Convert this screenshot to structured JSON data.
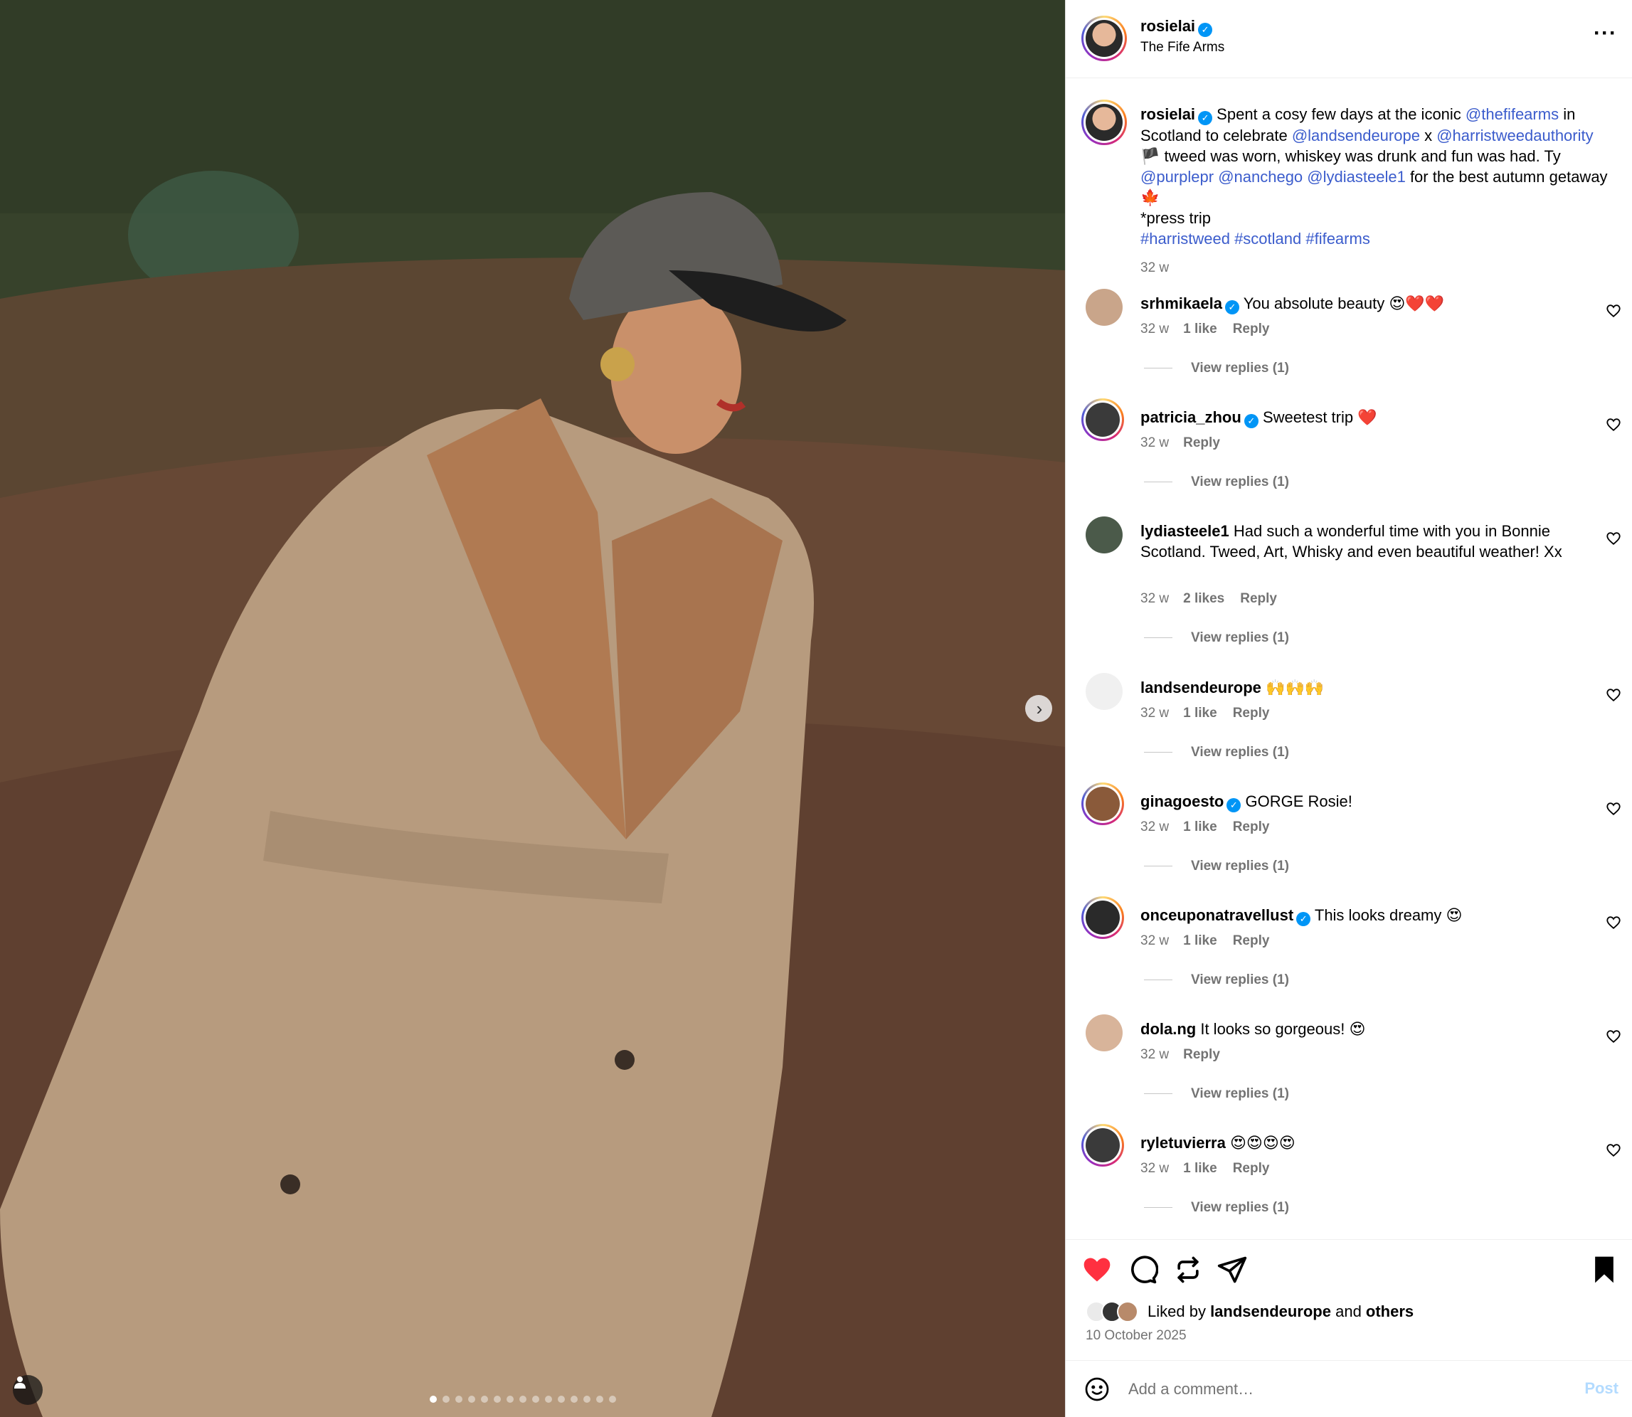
{
  "header": {
    "username": "rosielai",
    "location": "The Fife Arms"
  },
  "caption": {
    "username": "rosielai",
    "parts": [
      {
        "t": "Spent a cosy few days at the iconic ",
        "link": false
      },
      {
        "t": "@thefifearms",
        "link": true
      },
      {
        "t": " in Scotland to celebrate ",
        "link": false
      },
      {
        "t": "@landsendeurope",
        "link": true
      },
      {
        "t": " x ",
        "link": false
      },
      {
        "t": "@harristweedauthority",
        "link": true
      },
      {
        "t": " 🏴 tweed was worn, whiskey was drunk and fun was had. Ty ",
        "link": false
      },
      {
        "t": "@purplepr",
        "link": true
      },
      {
        "t": " ",
        "link": false
      },
      {
        "t": "@nanchego",
        "link": true
      },
      {
        "t": " ",
        "link": false
      },
      {
        "t": "@lydiasteele1",
        "link": true
      },
      {
        "t": " for the best autumn getaway 🍁",
        "link": false
      }
    ],
    "note": "*press trip",
    "hashtags": "#harristweed #scotland #fifearms",
    "time": "32 w"
  },
  "comments": [
    {
      "user": "srhmikaela",
      "verified": true,
      "text": "You absolute beauty 😍❤️❤️",
      "time": "32 w",
      "likes": "1 like",
      "reply": "Reply",
      "replies": "View replies (1)",
      "ring": false,
      "color": "#c9a58a"
    },
    {
      "user": "patricia_zhou",
      "verified": true,
      "text": "Sweetest trip ❤️",
      "time": "32 w",
      "likes": "",
      "reply": "Reply",
      "replies": "View replies (1)",
      "ring": true,
      "color": "#3a3a3a"
    },
    {
      "user": "lydiasteele1",
      "verified": false,
      "text": "Had such a wonderful time with you in Bonnie Scotland. Tweed, Art, Whisky and even beautiful weather! Xx",
      "time": "32 w",
      "likes": "2 likes",
      "reply": "Reply",
      "replies": "View replies (1)",
      "ring": false,
      "color": "#4b5a4a"
    },
    {
      "user": "landsendeurope",
      "verified": false,
      "text": "🙌🙌🙌",
      "time": "32 w",
      "likes": "1 like",
      "reply": "Reply",
      "replies": "View replies (1)",
      "ring": false,
      "color": "#f0f0f0"
    },
    {
      "user": "ginagoesto",
      "verified": true,
      "text": "GORGE Rosie!",
      "time": "32 w",
      "likes": "1 like",
      "reply": "Reply",
      "replies": "View replies (1)",
      "ring": true,
      "color": "#8a5a3a"
    },
    {
      "user": "onceuponatravellust",
      "verified": true,
      "text": "This looks dreamy 😍",
      "time": "32 w",
      "likes": "1 like",
      "reply": "Reply",
      "replies": "View replies (1)",
      "ring": true,
      "color": "#2a2a2a"
    },
    {
      "user": "dola.ng",
      "verified": false,
      "text": "It looks so gorgeous! 😍",
      "time": "32 w",
      "likes": "",
      "reply": "Reply",
      "replies": "View replies (1)",
      "ring": false,
      "color": "#d8b49a"
    },
    {
      "user": "ryletuvierra",
      "verified": false,
      "text": "😍😍😍😍",
      "time": "32 w",
      "likes": "1 like",
      "reply": "Reply",
      "replies": "View replies (1)",
      "ring": true,
      "color": "#3a3a3a"
    }
  ],
  "liked": {
    "prefix": "Liked by ",
    "user": "landsendeurope",
    "mid": " and ",
    "others": "others"
  },
  "date": "10 October 2025",
  "add_comment": {
    "placeholder": "Add a comment…",
    "post": "Post"
  },
  "icons": {
    "like": "heart-filled-icon",
    "comment": "comment-icon",
    "repost": "repost-icon",
    "share": "share-icon",
    "save": "bookmark-icon"
  },
  "colors": {
    "like": "#ff3040",
    "link": "#3b5ccc",
    "verified": "#0095f6",
    "post": "#b3dbff"
  },
  "carousel": {
    "slides": 15,
    "active": 1
  }
}
